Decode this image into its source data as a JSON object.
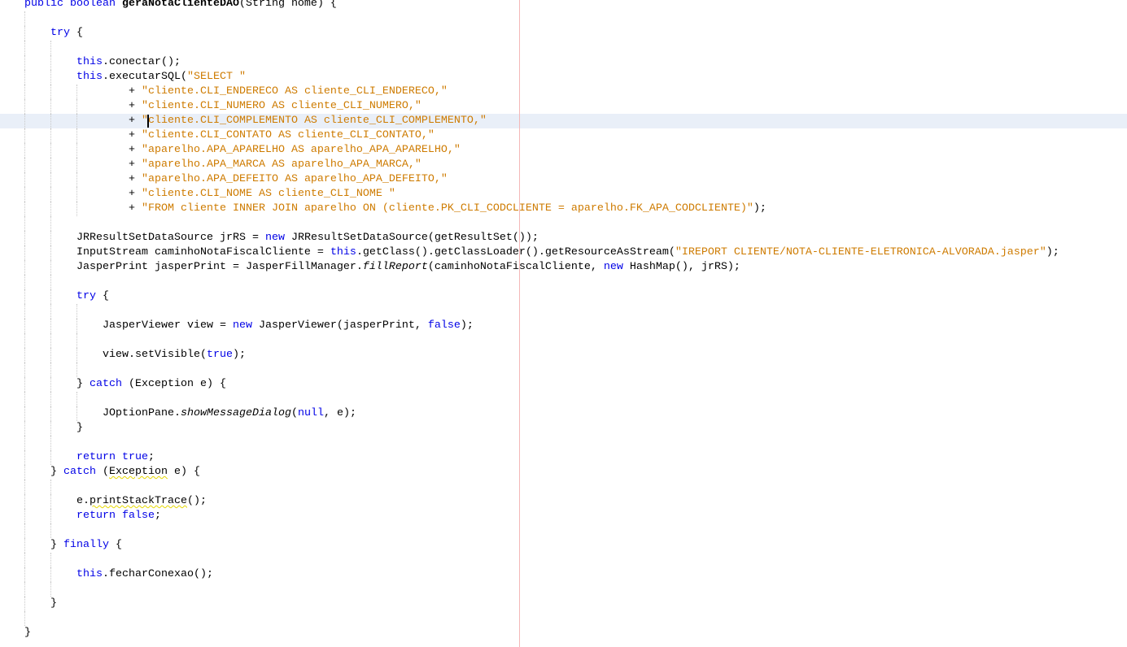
{
  "editor": {
    "current_line": 8,
    "caret_column": 19,
    "lines": [
      {
        "indent": 0,
        "tokens": [
          [
            "kw",
            "public boolean "
          ],
          [
            "bold",
            "geraNotaClienteDAO"
          ],
          [
            "",
            "(String nome) {"
          ]
        ]
      },
      {
        "indent": 0,
        "tokens": []
      },
      {
        "indent": 4,
        "tokens": [
          [
            "kw",
            "try"
          ],
          [
            "",
            " {"
          ]
        ]
      },
      {
        "indent": 0,
        "tokens": []
      },
      {
        "indent": 8,
        "tokens": [
          [
            "kw",
            "this"
          ],
          [
            "",
            ".conectar();"
          ]
        ]
      },
      {
        "indent": 8,
        "tokens": [
          [
            "kw",
            "this"
          ],
          [
            "",
            ".executarSQL("
          ],
          [
            "str",
            "\"SELECT \""
          ]
        ]
      },
      {
        "indent": 16,
        "tokens": [
          [
            "",
            "+ "
          ],
          [
            "str",
            "\"cliente.CLI_ENDERECO AS cliente_CLI_ENDERECO,\""
          ]
        ]
      },
      {
        "indent": 16,
        "tokens": [
          [
            "",
            "+ "
          ],
          [
            "str",
            "\"cliente.CLI_NUMERO AS cliente_CLI_NUMERO,\""
          ]
        ]
      },
      {
        "indent": 16,
        "tokens": [
          [
            "",
            "+ "
          ],
          [
            "str",
            "\"cliente.CLI_COMPLEMENTO AS cliente_CLI_COMPLEMENTO,\""
          ]
        ]
      },
      {
        "indent": 16,
        "tokens": [
          [
            "",
            "+ "
          ],
          [
            "str",
            "\"cliente.CLI_CONTATO AS cliente_CLI_CONTATO,\""
          ]
        ]
      },
      {
        "indent": 16,
        "tokens": [
          [
            "",
            "+ "
          ],
          [
            "str",
            "\"aparelho.APA_APARELHO AS aparelho_APA_APARELHO,\""
          ]
        ]
      },
      {
        "indent": 16,
        "tokens": [
          [
            "",
            "+ "
          ],
          [
            "str",
            "\"aparelho.APA_MARCA AS aparelho_APA_MARCA,\""
          ]
        ]
      },
      {
        "indent": 16,
        "tokens": [
          [
            "",
            "+ "
          ],
          [
            "str",
            "\"aparelho.APA_DEFEITO AS aparelho_APA_DEFEITO,\""
          ]
        ]
      },
      {
        "indent": 16,
        "tokens": [
          [
            "",
            "+ "
          ],
          [
            "str",
            "\"cliente.CLI_NOME AS cliente_CLI_NOME \""
          ]
        ]
      },
      {
        "indent": 16,
        "tokens": [
          [
            "",
            "+ "
          ],
          [
            "str",
            "\"FROM cliente INNER JOIN aparelho ON (cliente.PK_CLI_CODCLIENTE = aparelho.FK_APA_CODCLIENTE)\""
          ],
          [
            "",
            ");"
          ]
        ]
      },
      {
        "indent": 0,
        "tokens": []
      },
      {
        "indent": 8,
        "tokens": [
          [
            "",
            "JRResultSetDataSource jrRS = "
          ],
          [
            "kw",
            "new"
          ],
          [
            "",
            " JRResultSetDataSource(getResultSet());"
          ]
        ]
      },
      {
        "indent": 8,
        "tokens": [
          [
            "",
            "InputStream caminhoNotaFiscalCliente = "
          ],
          [
            "kw",
            "this"
          ],
          [
            "",
            ".getClass().getClassLoader().getResourceAsStream("
          ],
          [
            "str",
            "\"IREPORT CLIENTE/NOTA-CLIENTE-ELETRONICA-ALVORADA.jasper\""
          ],
          [
            "",
            ");"
          ]
        ]
      },
      {
        "indent": 8,
        "tokens": [
          [
            "",
            "JasperPrint jasperPrint = JasperFillManager."
          ],
          [
            "it",
            "fillReport"
          ],
          [
            "",
            "(caminhoNotaFiscalCliente, "
          ],
          [
            "kw",
            "new"
          ],
          [
            "",
            " HashMap(), jrRS);"
          ]
        ]
      },
      {
        "indent": 0,
        "tokens": []
      },
      {
        "indent": 8,
        "tokens": [
          [
            "kw",
            "try"
          ],
          [
            "",
            " {"
          ]
        ]
      },
      {
        "indent": 0,
        "tokens": []
      },
      {
        "indent": 12,
        "tokens": [
          [
            "",
            "JasperViewer view = "
          ],
          [
            "kw",
            "new"
          ],
          [
            "",
            " JasperViewer(jasperPrint, "
          ],
          [
            "kw",
            "false"
          ],
          [
            "",
            ");"
          ]
        ]
      },
      {
        "indent": 0,
        "tokens": []
      },
      {
        "indent": 12,
        "tokens": [
          [
            "",
            "view.setVisible("
          ],
          [
            "kw",
            "true"
          ],
          [
            "",
            ");"
          ]
        ]
      },
      {
        "indent": 0,
        "tokens": []
      },
      {
        "indent": 8,
        "tokens": [
          [
            "",
            "} "
          ],
          [
            "kw",
            "catch"
          ],
          [
            "",
            " (Exception e) {"
          ]
        ]
      },
      {
        "indent": 0,
        "tokens": []
      },
      {
        "indent": 12,
        "tokens": [
          [
            "",
            "JOptionPane."
          ],
          [
            "it",
            "showMessageDialog"
          ],
          [
            "",
            "("
          ],
          [
            "kw",
            "null"
          ],
          [
            "",
            ", e);"
          ]
        ]
      },
      {
        "indent": 8,
        "tokens": [
          [
            "",
            "}"
          ]
        ]
      },
      {
        "indent": 0,
        "tokens": []
      },
      {
        "indent": 8,
        "tokens": [
          [
            "kw",
            "return true"
          ],
          [
            "",
            ";"
          ]
        ]
      },
      {
        "indent": 4,
        "tokens": [
          [
            "",
            "} "
          ],
          [
            "kw",
            "catch"
          ],
          [
            "",
            " ("
          ],
          [
            "warn",
            "Exception"
          ],
          [
            "",
            " e) {"
          ]
        ]
      },
      {
        "indent": 0,
        "tokens": []
      },
      {
        "indent": 8,
        "tokens": [
          [
            "",
            "e."
          ],
          [
            "warn",
            "printStackTrace"
          ],
          [
            "",
            "();"
          ]
        ]
      },
      {
        "indent": 8,
        "tokens": [
          [
            "kw",
            "return false"
          ],
          [
            "",
            ";"
          ]
        ]
      },
      {
        "indent": 0,
        "tokens": []
      },
      {
        "indent": 4,
        "tokens": [
          [
            "",
            "} "
          ],
          [
            "kw",
            "finally"
          ],
          [
            "",
            " {"
          ]
        ]
      },
      {
        "indent": 0,
        "tokens": []
      },
      {
        "indent": 8,
        "tokens": [
          [
            "kw",
            "this"
          ],
          [
            "",
            ".fecharConexao();"
          ]
        ]
      },
      {
        "indent": 0,
        "tokens": []
      },
      {
        "indent": 4,
        "tokens": [
          [
            "",
            "}"
          ]
        ]
      },
      {
        "indent": 0,
        "tokens": []
      },
      {
        "indent": 0,
        "tokens": [
          [
            "",
            "}"
          ]
        ]
      }
    ]
  }
}
